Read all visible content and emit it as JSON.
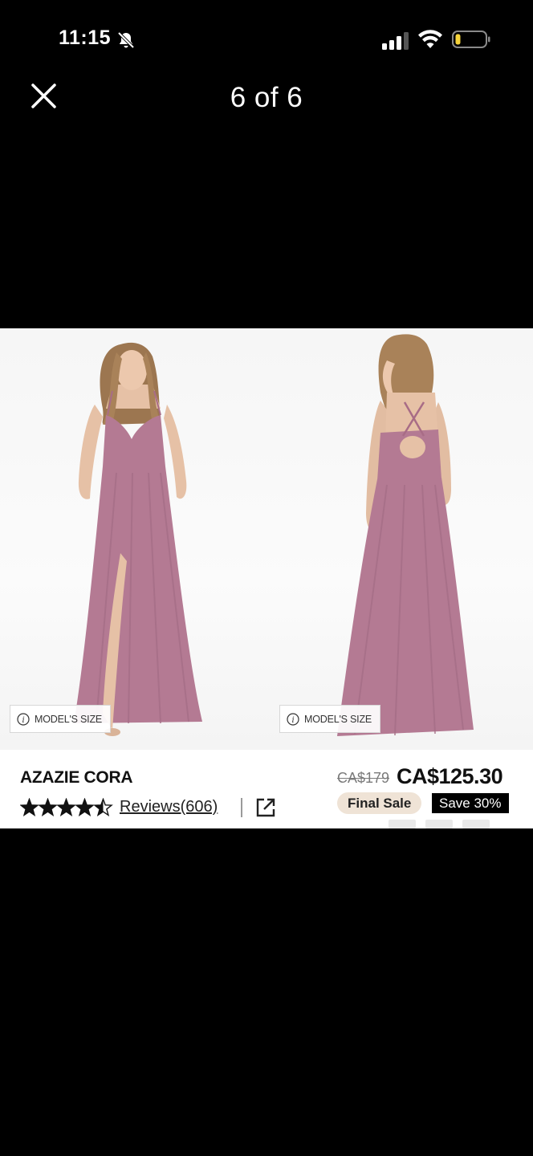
{
  "status_bar": {
    "time": "11:15",
    "icons": [
      "bell-slash-icon",
      "cellular-signal-icon",
      "wifi-icon",
      "battery-low-icon"
    ]
  },
  "viewer": {
    "title": "6 of 6",
    "close_icon": "close-icon"
  },
  "product": {
    "name": "AZAZIE CORA",
    "original_price": "CA$179",
    "price": "CA$125.30",
    "rating": 4.5,
    "reviews_label": "Reviews(606)",
    "final_sale_label": "Final Sale",
    "save_label": "Save 30%",
    "model_size_label": "MODEL'S SIZE"
  },
  "colors": {
    "dress": "#b47a93",
    "badge_bg": "#efe3d6",
    "battery_level": "#f5d33b"
  }
}
